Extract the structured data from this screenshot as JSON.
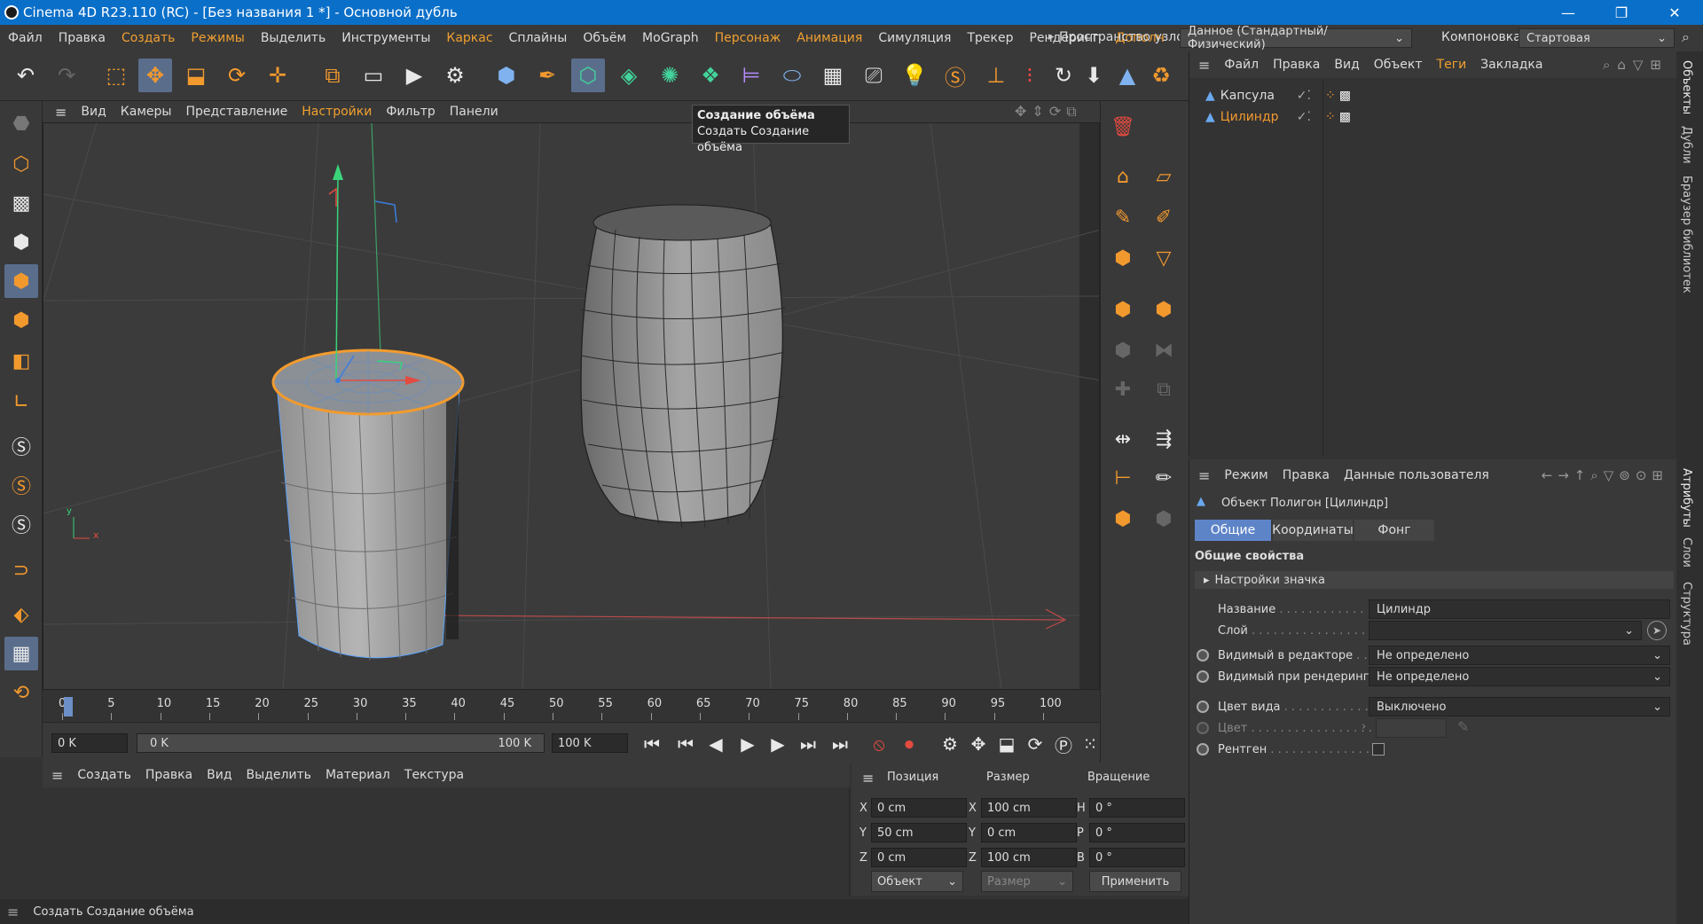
{
  "window": {
    "title": "Cinema 4D R23.110 (RC) - [Без названия 1 *] - Основной дубль",
    "controls": [
      "—",
      "❐",
      "✕"
    ]
  },
  "menu": {
    "items": [
      {
        "label": "Файл",
        "accent": false
      },
      {
        "label": "Правка",
        "accent": false
      },
      {
        "label": "Создать",
        "accent": true
      },
      {
        "label": "Режимы",
        "accent": true
      },
      {
        "label": "Выделить",
        "accent": false
      },
      {
        "label": "Инструменты",
        "accent": false
      },
      {
        "label": "Каркас",
        "accent": true
      },
      {
        "label": "Сплайны",
        "accent": false
      },
      {
        "label": "Объём",
        "accent": false
      },
      {
        "label": "MoGraph",
        "accent": false
      },
      {
        "label": "Персонаж",
        "accent": true
      },
      {
        "label": "Анимация",
        "accent": true
      },
      {
        "label": "Симуляция",
        "accent": false
      },
      {
        "label": "Трекер",
        "accent": false
      },
      {
        "label": "Рендеринг",
        "accent": false
      },
      {
        "label": "Дополн",
        "accent": true
      }
    ],
    "more_arrow": "▸",
    "node_space_label": "Пространство узлов:",
    "node_space_value": "Данное (Стандартный/Физический)",
    "layout_label": "Компоновка",
    "layout_value": "Стартовая"
  },
  "viewport": {
    "menu": [
      "Вид",
      "Камеры",
      "Представление",
      "Настройки",
      "Фильтр",
      "Панели"
    ],
    "tooltip_title": "Создание объёма",
    "tooltip_text": "Создать Создание объёма",
    "axis_x": "x",
    "axis_y": "y"
  },
  "timeline": {
    "ticks": [
      "0",
      "5",
      "10",
      "15",
      "20",
      "25",
      "30",
      "35",
      "40",
      "45",
      "50",
      "55",
      "60",
      "65",
      "70",
      "75",
      "80",
      "85",
      "90",
      "95",
      "100"
    ],
    "current_frame_display": "0 K",
    "start_field": "0 K",
    "range_start": "0 K",
    "range_end": "100 K",
    "end_field": "100 K"
  },
  "material_manager": {
    "menu": [
      "Создать",
      "Правка",
      "Вид",
      "Выделить",
      "Материал",
      "Текстура"
    ]
  },
  "coordinates": {
    "headers": {
      "position": "Позиция",
      "size": "Размер",
      "rotation": "Вращение"
    },
    "rows": [
      {
        "axis": "X",
        "pos": "0 cm",
        "size_axis": "X",
        "size": "100 cm",
        "rot_axis": "H",
        "rot": "0 °"
      },
      {
        "axis": "Y",
        "pos": "50 cm",
        "size_axis": "Y",
        "size": "0 cm",
        "rot_axis": "P",
        "rot": "0 °"
      },
      {
        "axis": "Z",
        "pos": "0 cm",
        "size_axis": "Z",
        "size": "100 cm",
        "rot_axis": "B",
        "rot": "0 °"
      }
    ],
    "mode_select": "Объект",
    "size_select": "Размер",
    "apply_button": "Применить"
  },
  "object_manager": {
    "menu": [
      "Файл",
      "Правка",
      "Вид",
      "Объект",
      "Теги",
      "Закладка"
    ],
    "objects": [
      {
        "name": "Капсула",
        "selected": false
      },
      {
        "name": "Цилиндр",
        "selected": true
      }
    ]
  },
  "attribute_manager": {
    "menu": [
      "Режим",
      "Правка",
      "Данные пользователя"
    ],
    "object_title": "Объект Полигон [Цилиндр]",
    "tabs": [
      "Общие",
      "Координаты",
      "Фонг"
    ],
    "section_title": "Общие свойства",
    "icon_settings": "Настройки значка",
    "props": {
      "name_label": "Название",
      "name_value": "Цилиндр",
      "layer_label": "Слой",
      "layer_value": "",
      "vis_editor_label": "Видимый в редакторе",
      "vis_editor_value": "Не определено",
      "vis_render_label": "Видимый при рендеринге",
      "vis_render_value": "Не определено",
      "display_color_label": "Цвет вида",
      "display_color_value": "Выключено",
      "color_label": "Цвет",
      "xray_label": "Рентген"
    }
  },
  "right_tabs": [
    "Объекты",
    "Дубли",
    "Браузер библиотек",
    "Атрибуты",
    "Слои",
    "Структура"
  ],
  "status": {
    "text": "Создать Создание объёма"
  },
  "colors": {
    "accent_orange": "#f2992e",
    "selection_blue": "#5e84c8",
    "title_blue": "#0a6fc8"
  }
}
